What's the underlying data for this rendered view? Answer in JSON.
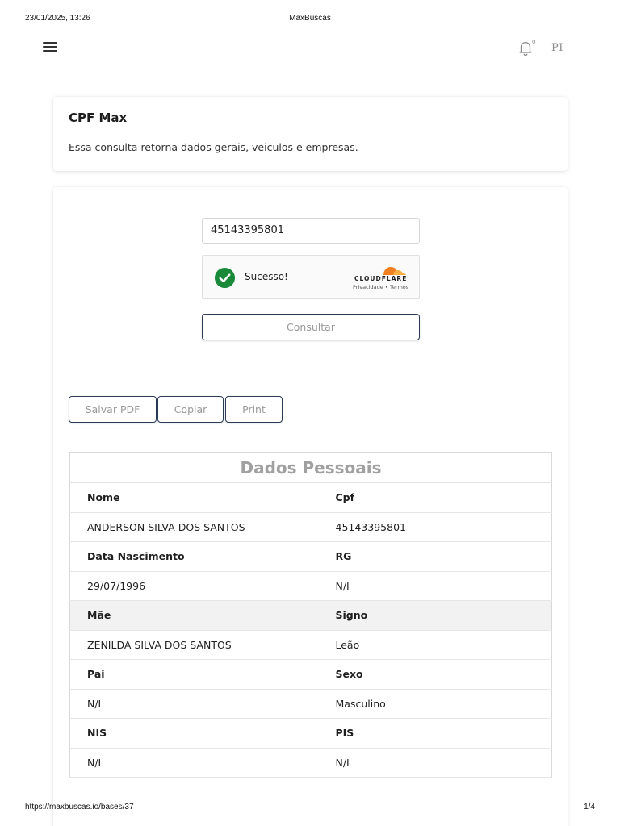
{
  "print": {
    "datetime": "23/01/2025, 13:26",
    "title": "MaxBuscas",
    "url": "https://maxbuscas.io/bases/37",
    "page": "1/4"
  },
  "topbar": {
    "menu_icon": "hamburger-menu-icon",
    "bell_icon": "bell-icon",
    "notification_count": "0",
    "avatar_initials": "PI"
  },
  "info_card": {
    "title": "CPF Max",
    "description": "Essa consulta retorna dados gerais, veiculos e empresas."
  },
  "query": {
    "cpf_value": "45143395801",
    "captcha": {
      "status_text": "Sucesso!",
      "provider": "CLOUDFLARE",
      "privacy_link": "Privacidade",
      "separator": "•",
      "terms_link": "Termos"
    },
    "submit_label": "Consultar"
  },
  "actions": {
    "save_pdf": "Salvar PDF",
    "copy": "Copiar",
    "print": "Print"
  },
  "dados_pessoais": {
    "title": "Dados Pessoais",
    "rows": [
      {
        "label_left": "Nome",
        "label_right": "Cpf",
        "value_left": "ANDERSON SILVA DOS SANTOS",
        "value_right": "45143395801"
      },
      {
        "label_left": "Data Nascimento",
        "label_right": "RG",
        "value_left": "29/07/1996",
        "value_right": "N/I"
      },
      {
        "label_left": "Mãe",
        "label_right": "Signo",
        "value_left": "ZENILDA SILVA DOS SANTOS",
        "value_right": "Leão"
      },
      {
        "label_left": "Pai",
        "label_right": "Sexo",
        "value_left": "N/I",
        "value_right": "Masculino"
      },
      {
        "label_left": "NIS",
        "label_right": "PIS",
        "value_left": "N/I",
        "value_right": "N/I"
      }
    ]
  },
  "colors": {
    "button_border": "#2b3a55",
    "success_green": "#1a8a3a",
    "cloudflare_orange": "#f38020"
  }
}
